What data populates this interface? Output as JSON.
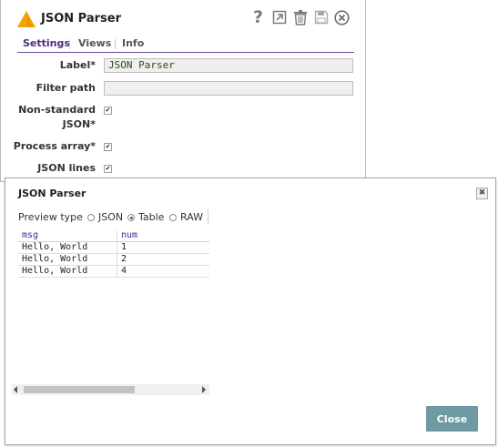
{
  "settings_dialog": {
    "title": "JSON Parser",
    "tabs": [
      {
        "label": "Settings",
        "active": true
      },
      {
        "label": "Views",
        "active": false
      },
      {
        "label": "Info",
        "active": false
      }
    ],
    "fields": {
      "label": {
        "label": "Label*",
        "value": "JSON Parser"
      },
      "filter_path": {
        "label": "Filter path",
        "value": ""
      },
      "non_standard_json": {
        "label_line1": "Non-standard",
        "label_line2": "JSON*",
        "checked": true
      },
      "process_array": {
        "label": "Process array*",
        "checked": true
      },
      "json_lines": {
        "label": "JSON lines",
        "checked": true
      }
    },
    "toolbar_icons": [
      "help-icon",
      "export-icon",
      "delete-icon",
      "save-icon",
      "close-circle-icon"
    ],
    "accent_color": "#4b2e7f",
    "snap_icon_color": "#f0a500"
  },
  "preview_dialog": {
    "title": "JSON Parser",
    "preview_type": {
      "label": "Preview type",
      "options": [
        {
          "label": "JSON",
          "checked": false
        },
        {
          "label": "Table",
          "checked": true
        },
        {
          "label": "RAW",
          "checked": false
        }
      ]
    },
    "table": {
      "columns": [
        "msg",
        "num"
      ],
      "rows": [
        [
          "Hello, World",
          "1"
        ],
        [
          "Hello, World",
          "2"
        ],
        [
          "Hello, World",
          "4"
        ]
      ]
    },
    "close_button_label": "Close",
    "close_button_color": "#6f9aa4"
  }
}
